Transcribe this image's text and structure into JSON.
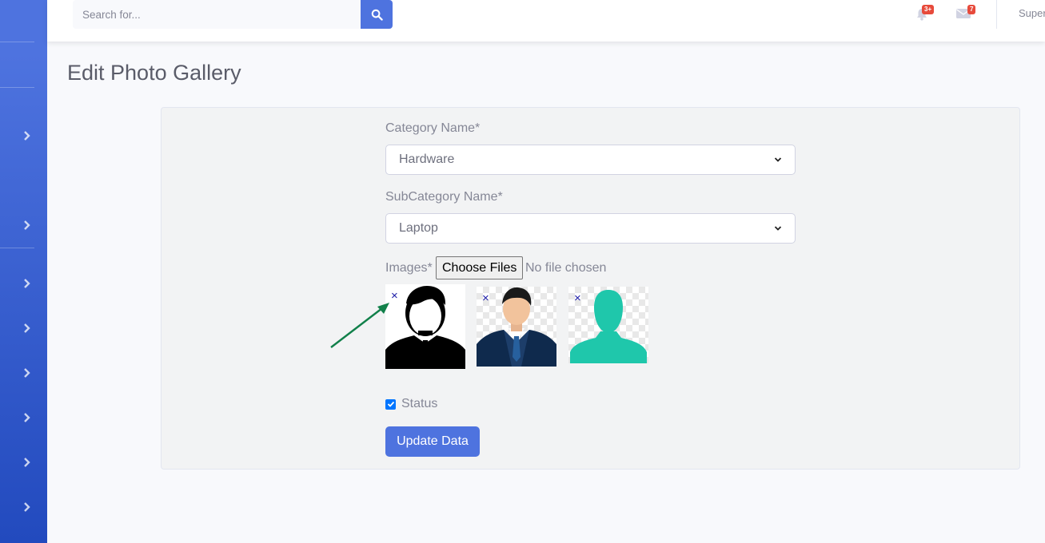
{
  "search": {
    "placeholder": "Search for..."
  },
  "topbar": {
    "alerts_badge": "3+",
    "messages_badge": "7",
    "user_name": "Super"
  },
  "page": {
    "title": "Edit Photo Gallery"
  },
  "form": {
    "category_label": "Category Name*",
    "category_value": "Hardware",
    "subcategory_label": "SubCategory Name*",
    "subcategory_value": "Laptop",
    "images_label": "Images*",
    "choose_files_label": "Choose Files",
    "file_status": "No file chosen",
    "remove_glyph": "×",
    "images": [
      {
        "icon": "businessman-silhouette-image"
      },
      {
        "icon": "businessman-avatar-image"
      },
      {
        "icon": "teal-person-silhouette-image"
      }
    ],
    "status_label": "Status",
    "status_checked": true,
    "submit_label": "Update Data"
  },
  "colors": {
    "primary": "#4e73df",
    "badge": "#e74a3b",
    "annotation_arrow": "#11804a",
    "teal_avatar": "#1fc7ab"
  }
}
